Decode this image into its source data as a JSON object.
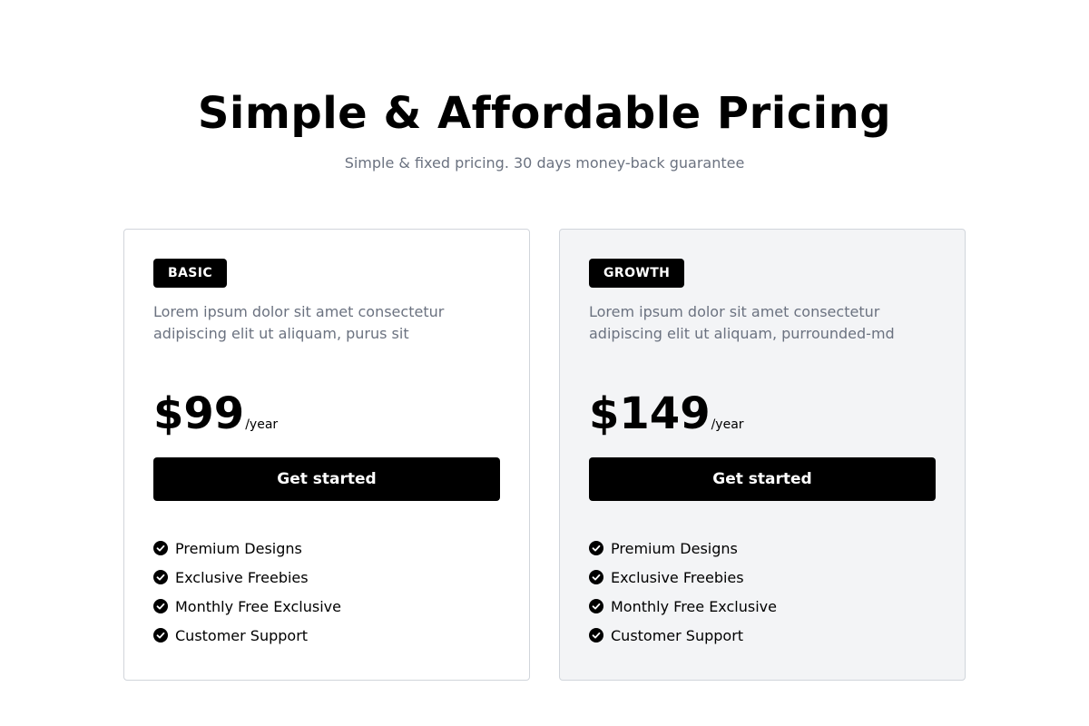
{
  "header": {
    "title": "Simple & Affordable Pricing",
    "subtitle": "Simple & fixed pricing. 30 days money-back guarantee"
  },
  "plans": [
    {
      "badge": "BASIC",
      "description": "Lorem ipsum dolor sit amet consectetur adipiscing elit ut aliquam, purus sit",
      "price": "$99",
      "period": "/year",
      "cta_label": "Get started",
      "features": [
        "Premium Designs",
        "Exclusive Freebies",
        "Monthly Free Exclusive",
        "Customer Support"
      ],
      "background": "#ffffff"
    },
    {
      "badge": "GROWTH",
      "description": "Lorem ipsum dolor sit amet consectetur adipiscing elit ut aliquam, purrounded-md",
      "price": "$149",
      "period": "/year",
      "cta_label": "Get started",
      "features": [
        "Premium Designs",
        "Exclusive Freebies",
        "Monthly Free Exclusive",
        "Customer Support"
      ],
      "background": "#f3f4f6"
    }
  ],
  "icons": {
    "feature_bullet": "check-circle-icon"
  },
  "colors": {
    "accent": "#000000",
    "muted_text": "#6b7280",
    "border": "#d1d5db"
  }
}
